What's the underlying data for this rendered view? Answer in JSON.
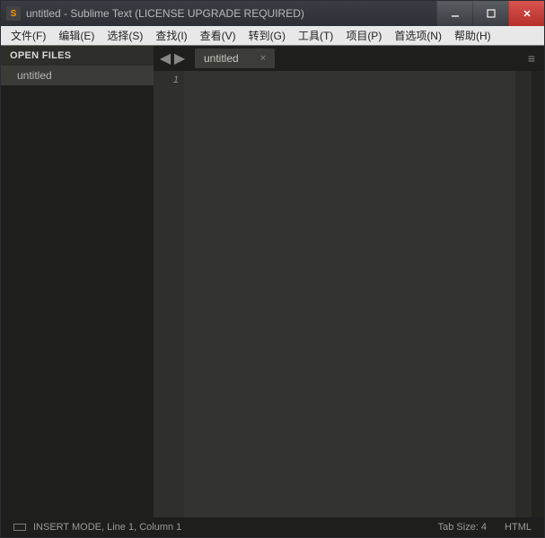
{
  "titlebar": {
    "app_icon_text": "S",
    "title": "untitled - Sublime Text (LICENSE UPGRADE REQUIRED)"
  },
  "menubar": {
    "items": [
      {
        "label": "文件(F)"
      },
      {
        "label": "编辑(E)"
      },
      {
        "label": "选择(S)"
      },
      {
        "label": "查找(I)"
      },
      {
        "label": "查看(V)"
      },
      {
        "label": "转到(G)"
      },
      {
        "label": "工具(T)"
      },
      {
        "label": "项目(P)"
      },
      {
        "label": "首选项(N)"
      },
      {
        "label": "帮助(H)"
      }
    ]
  },
  "sidebar": {
    "header": "OPEN FILES",
    "files": [
      {
        "name": "untitled"
      }
    ]
  },
  "tabs": {
    "active": {
      "label": "untitled",
      "close": "×"
    }
  },
  "gutter": {
    "lines": [
      "1"
    ]
  },
  "statusbar": {
    "mode": "INSERT MODE, Line 1, Column 1",
    "tabsize": "Tab Size: 4",
    "syntax": "HTML"
  },
  "glyphs": {
    "nav_prev": "◀",
    "nav_next": "▶",
    "hamburger": "≡"
  }
}
